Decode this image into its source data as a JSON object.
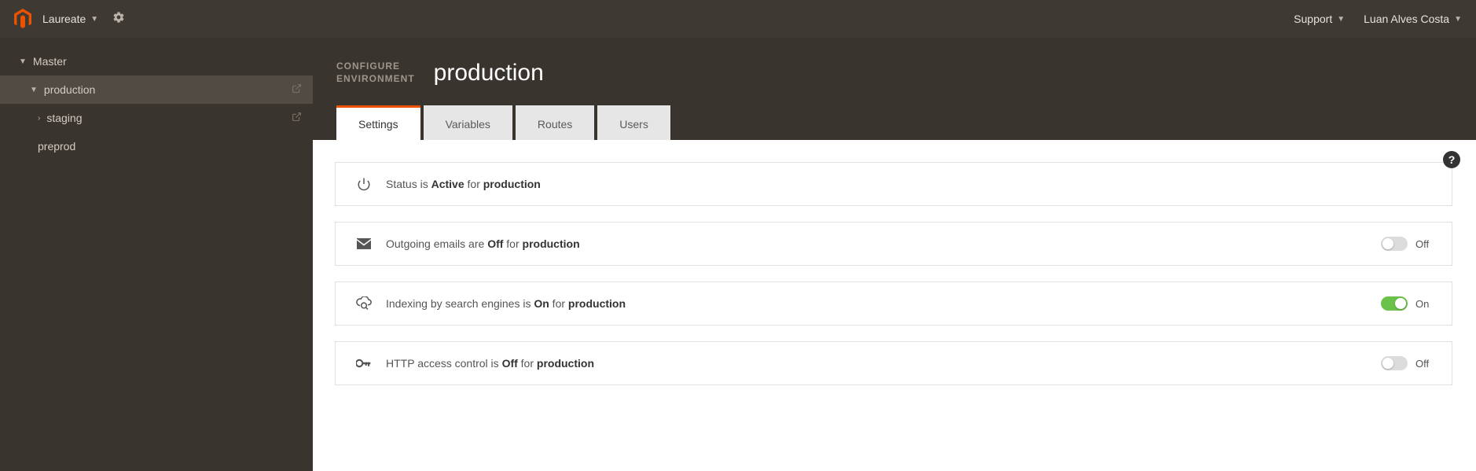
{
  "topbar": {
    "project": "Laureate",
    "support": "Support",
    "user": "Luan Alves Costa"
  },
  "sidebar": {
    "master": "Master",
    "production": "production",
    "staging": "staging",
    "preprod": "preprod"
  },
  "header": {
    "pretitle_l1": "CONFIGURE",
    "pretitle_l2": "ENVIRONMENT",
    "title": "production"
  },
  "tabs": {
    "settings": "Settings",
    "variables": "Variables",
    "routes": "Routes",
    "users": "Users"
  },
  "panels": {
    "status": {
      "t1": "Status is ",
      "b1": "Active",
      "t2": " for ",
      "b2": "production"
    },
    "emails": {
      "t1": "Outgoing emails are ",
      "b1": "Off",
      "t2": " for ",
      "b2": "production",
      "toggle": "Off"
    },
    "indexing": {
      "t1": "Indexing by search engines is ",
      "b1": "On",
      "t2": " for ",
      "b2": "production",
      "toggle": "On"
    },
    "http": {
      "t1": "HTTP access control is ",
      "b1": "Off",
      "t2": " for ",
      "b2": "production",
      "toggle": "Off"
    }
  }
}
